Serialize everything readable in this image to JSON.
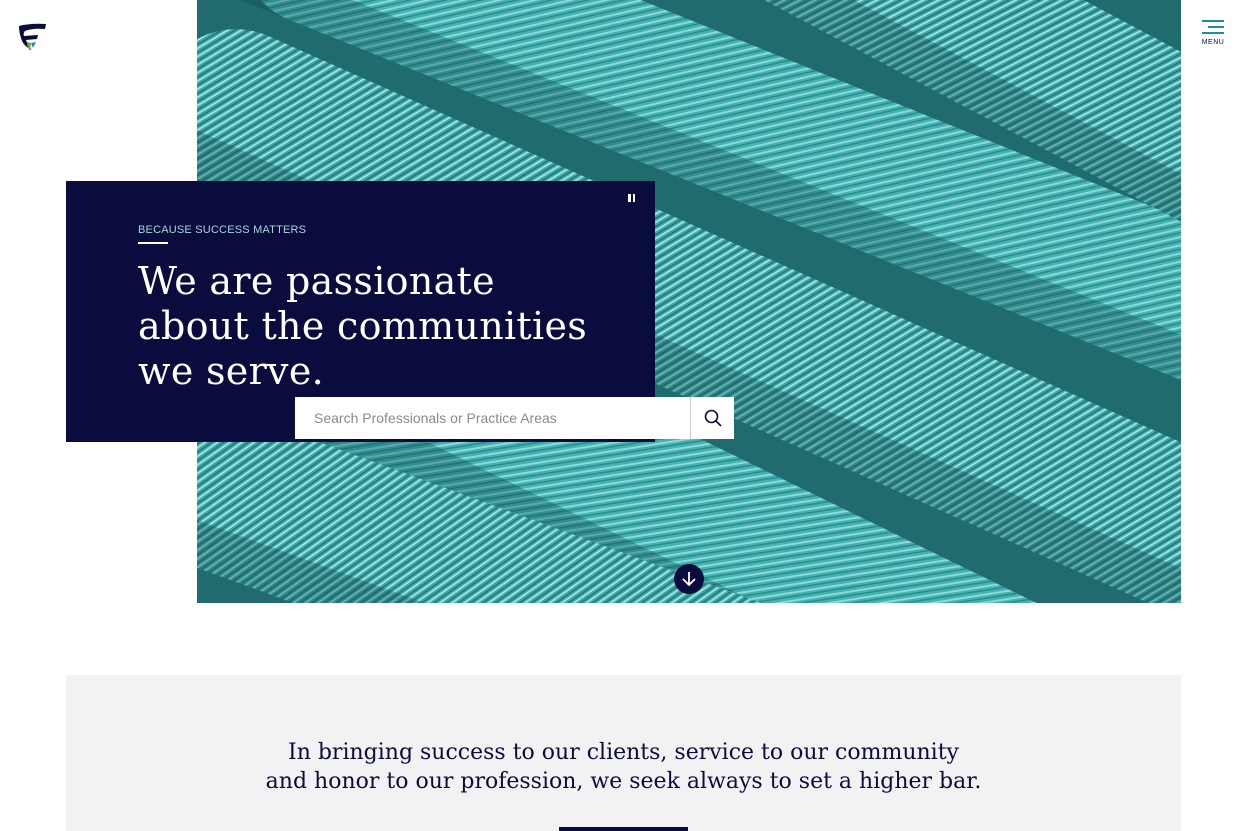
{
  "header": {
    "logo_icon": "firm-f-logo-icon",
    "menu_label": "MENU"
  },
  "hero": {
    "eyebrow": "BECAUSE SUCCESS MATTERS",
    "headline_lines": [
      "We are passionate",
      "about the communities",
      "we serve."
    ],
    "pause_icon": "pause-icon",
    "scroll_icon": "arrow-down-circle-icon",
    "image": "teal-rope-texture"
  },
  "search": {
    "placeholder": "Search Professionals or Practice Areas",
    "value": "",
    "button_icon": "search-icon"
  },
  "tagline": {
    "lines": [
      "In bringing success to our clients, service to our community",
      "and honor to our profession, we seek always to set a higher bar."
    ]
  },
  "colors": {
    "navy": "#0a0c3d",
    "teal": "#1c8f9a",
    "rope": "#3aa9a8",
    "light_section": "#f2f2f2"
  }
}
